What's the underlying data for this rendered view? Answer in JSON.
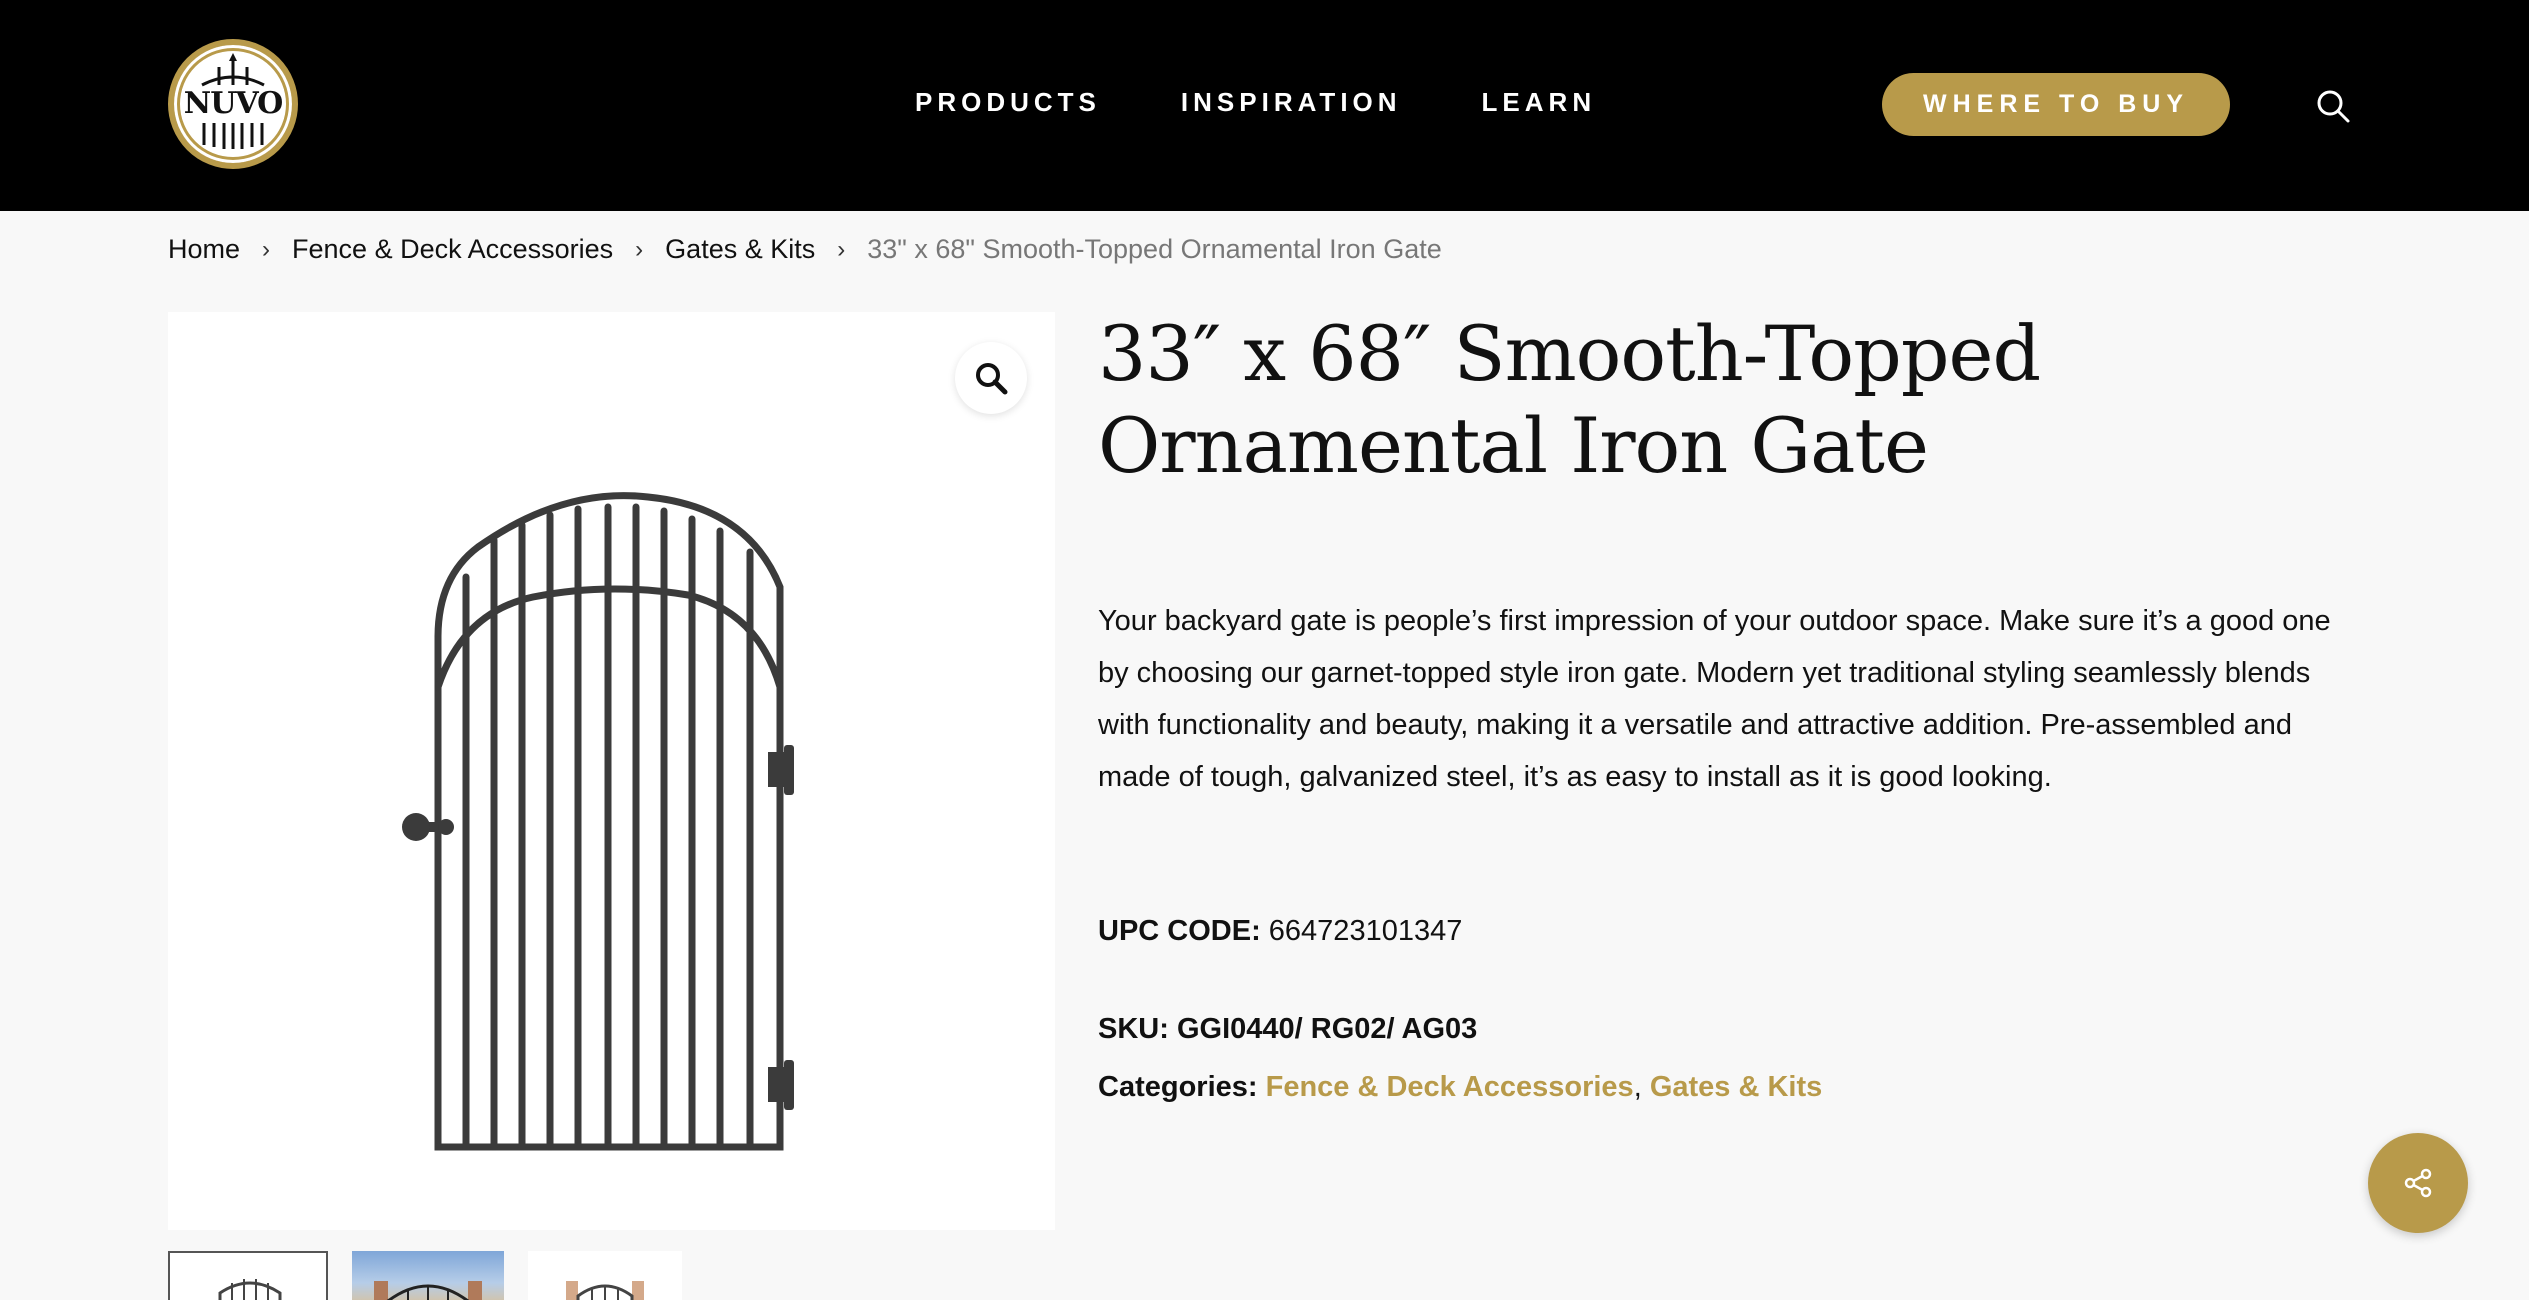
{
  "header": {
    "logo_text": "NUVO",
    "nav": [
      "PRODUCTS",
      "INSPIRATION",
      "LEARN"
    ],
    "buy_label": "WHERE TO BUY",
    "search_icon": "search-icon"
  },
  "breadcrumb": {
    "items": [
      "Home",
      "Fence & Deck Accessories",
      "Gates & Kits"
    ],
    "current": "33\" x 68\" Smooth-Topped Ornamental Iron Gate"
  },
  "product": {
    "title": "33″ x 68″ Smooth-Topped Ornamental Iron Gate",
    "description": "Your backyard gate is people’s first impression of your outdoor space. Make sure it’s a good one by choosing our garnet-topped style iron gate. Modern yet traditional styling seamlessly blends with functionality and beauty, making it a versatile and attractive addition. Pre-assembled and made of tough, galvanized steel, it’s as easy to install as it is good looking.",
    "upc_label": "UPC CODE:",
    "upc_value": "664723101347",
    "sku_label": "SKU:",
    "sku_value": "GGI0440/ RG02/ AG03",
    "categories_label": "Categories:",
    "categories": [
      "Fence & Deck Accessories",
      "Gates & Kits"
    ],
    "categories_sep": ","
  },
  "colors": {
    "accent": "#b89a4a",
    "header_bg": "#000000",
    "page_bg": "#f8f8f8"
  },
  "icons": [
    "search-icon",
    "zoom-icon",
    "share-icon",
    "chevron-right-icon"
  ]
}
